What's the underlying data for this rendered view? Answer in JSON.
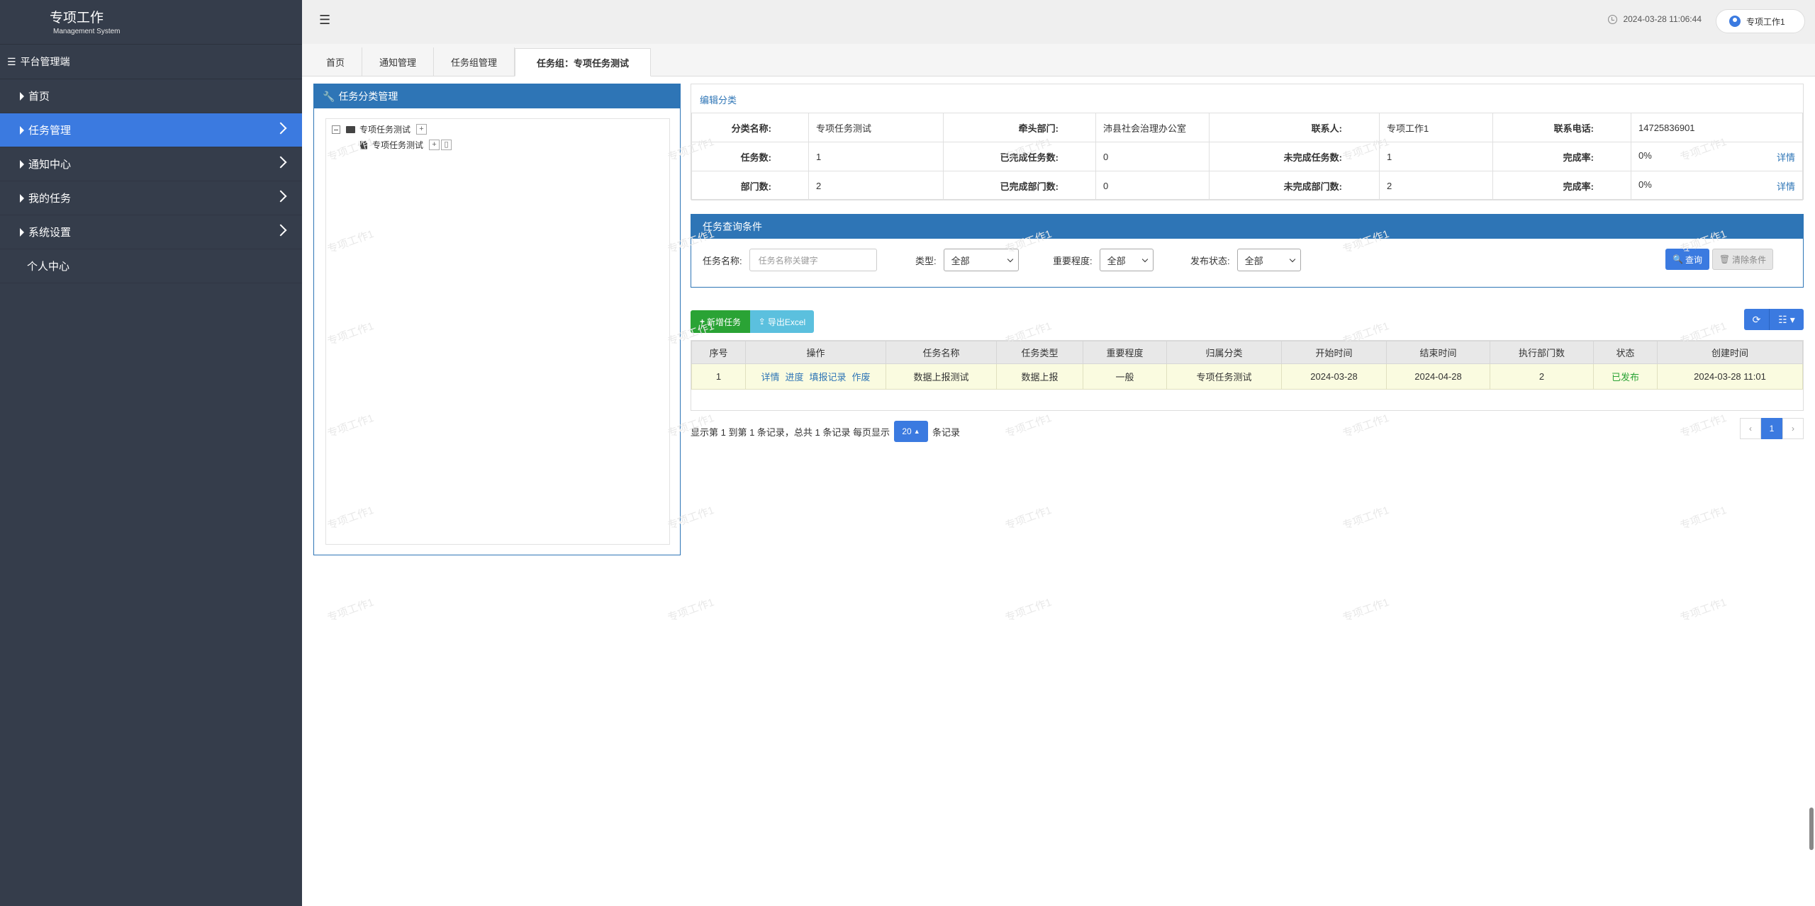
{
  "brand": {
    "title": "专项工作",
    "subtitle": "Management System"
  },
  "sidebar": {
    "header": "平台管理端",
    "items": [
      {
        "label": "首页"
      },
      {
        "label": "任务管理"
      },
      {
        "label": "通知中心"
      },
      {
        "label": "我的任务"
      },
      {
        "label": "系统设置"
      },
      {
        "label": "个人中心"
      }
    ]
  },
  "topbar": {
    "datetime": "2024-03-28 11:06:44",
    "user": "专项工作1"
  },
  "tabs": [
    {
      "label": "首页"
    },
    {
      "label": "通知管理"
    },
    {
      "label": "任务组管理"
    },
    {
      "label": "任务组：专项任务测试"
    }
  ],
  "left_panel": {
    "title": "任务分类管理",
    "tree": {
      "root": "专项任务测试",
      "child": "专项任务测试"
    }
  },
  "info": {
    "edit_link": "编辑分类",
    "row1": {
      "l1": "分类名称:",
      "v1": "专项任务测试",
      "l2": "牵头部门:",
      "v2": "沛县社会治理办公室",
      "l3": "联系人:",
      "v3": "专项工作1",
      "l4": "联系电话:",
      "v4": "14725836901"
    },
    "row2": {
      "l1": "任务数:",
      "v1": "1",
      "l2": "已完成任务数:",
      "v2": "0",
      "l3": "未完成任务数:",
      "v3": "1",
      "l4": "完成率:",
      "v4": "0%",
      "detail": "详情"
    },
    "row3": {
      "l1": "部门数:",
      "v1": "2",
      "l2": "已完成部门数:",
      "v2": "0",
      "l3": "未完成部门数:",
      "v3": "2",
      "l4": "完成率:",
      "v4": "0%",
      "detail": "详情"
    }
  },
  "query": {
    "title": "任务查询条件",
    "name_label": "任务名称:",
    "name_placeholder": "任务名称关键字",
    "type_label": "类型:",
    "type_value": "全部",
    "importance_label": "重要程度:",
    "importance_value": "全部",
    "status_label": "发布状态:",
    "status_value": "全部",
    "search_btn": "查询",
    "clear_btn": "清除条件"
  },
  "toolbar": {
    "add": "新增任务",
    "export": "导出Excel"
  },
  "grid": {
    "headers": [
      "序号",
      "操作",
      "任务名称",
      "任务类型",
      "重要程度",
      "归属分类",
      "开始时间",
      "结束时间",
      "执行部门数",
      "状态",
      "创建时间"
    ],
    "rows": [
      {
        "no": "1",
        "ops": [
          "详情",
          "进度",
          "填报记录",
          "作废"
        ],
        "name": "数据上报测试",
        "type": "数据上报",
        "importance": "一般",
        "category": "专项任务测试",
        "start": "2024-03-28",
        "end": "2024-04-28",
        "depts": "2",
        "status": "已发布",
        "created": "2024-03-28 11:01"
      }
    ]
  },
  "pagination": {
    "prefix": "显示第 1 到第 1 条记录，总共 1 条记录 每页显示",
    "size": "20",
    "suffix": "条记录",
    "current": "1",
    "prev": "‹",
    "next": "›"
  },
  "watermark": "专项工作1",
  "colors": {
    "sidebar": "#353d4b",
    "accent": "#3b7ae0",
    "panel": "#2e75b6",
    "success": "#2aa335"
  }
}
